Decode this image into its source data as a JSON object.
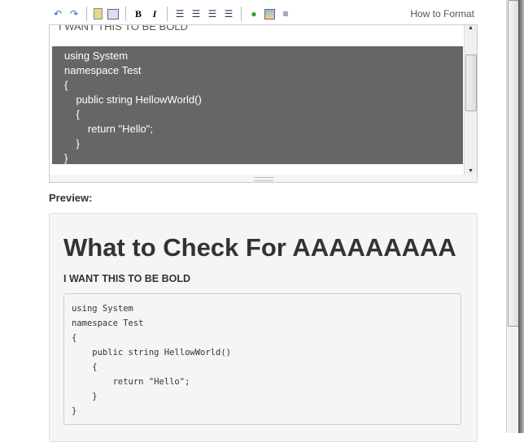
{
  "toolbar": {
    "icons": [
      "undo-icon",
      "redo-icon",
      "paragraph-icon",
      "code-block-icon",
      "bold-icon",
      "italic-icon",
      "bullet-list-icon",
      "numbered-list-icon",
      "outdent-icon",
      "indent-icon",
      "link-icon",
      "image-icon",
      "horizontal-rule-icon"
    ],
    "bold": "B",
    "italic": "I",
    "how_to_format": "How to Format"
  },
  "editor": {
    "partial_line": "I WANT THIS TO BE BOLD",
    "code": "using System\nnamespace Test\n{\n    public string HellowWorld()\n    {\n        return \"Hello\";\n    }\n}"
  },
  "preview": {
    "label": "Preview:",
    "heading": "What to Check For AAAAAAAAA",
    "subheading": "I WANT THIS TO BE BOLD",
    "code": "using System\nnamespace Test\n{\n    public string HellowWorld()\n    {\n        return \"Hello\";\n    }\n}"
  }
}
